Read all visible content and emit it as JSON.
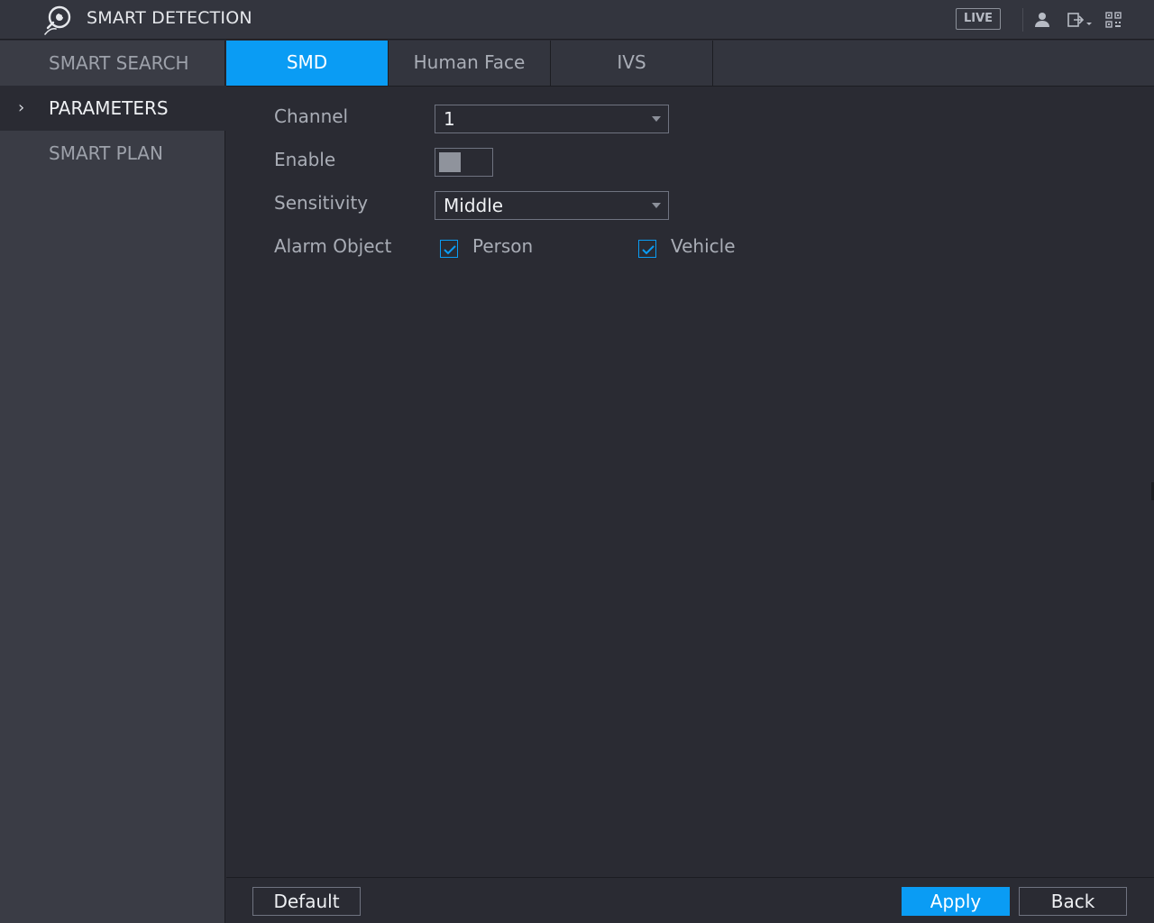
{
  "header": {
    "title": "SMART DETECTION",
    "live_label": "LIVE",
    "icons": [
      "smart-detection-logo-icon",
      "user-icon",
      "logout-icon",
      "qr-code-icon"
    ]
  },
  "sidebar": {
    "items": [
      {
        "label": "SMART SEARCH",
        "active": false
      },
      {
        "label": "PARAMETERS",
        "active": true
      },
      {
        "label": "SMART PLAN",
        "active": false
      }
    ]
  },
  "tabs": [
    {
      "label": "SMD",
      "active": true
    },
    {
      "label": "Human Face",
      "active": false
    },
    {
      "label": "IVS",
      "active": false
    }
  ],
  "form": {
    "channel_label": "Channel",
    "channel_value": "1",
    "enable_label": "Enable",
    "enable_on": false,
    "sensitivity_label": "Sensitivity",
    "sensitivity_value": "Middle",
    "alarm_object_label": "Alarm Object",
    "person_label": "Person",
    "person_checked": true,
    "vehicle_label": "Vehicle",
    "vehicle_checked": true
  },
  "footer": {
    "default_label": "Default",
    "apply_label": "Apply",
    "back_label": "Back"
  },
  "colors": {
    "accent": "#0a9cf4",
    "background": "#2a2b33",
    "sidebar": "#3a3c45"
  }
}
